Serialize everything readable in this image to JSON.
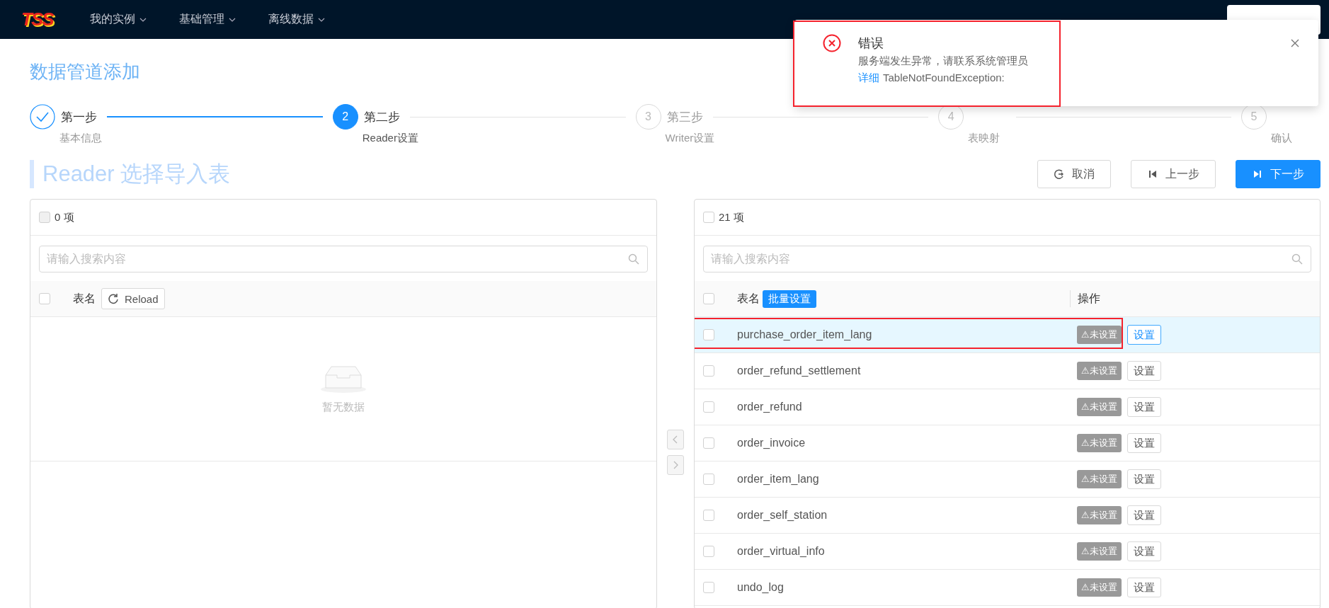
{
  "nav": {
    "logo": "TSS",
    "menus": [
      {
        "label": "我的实例"
      },
      {
        "label": "基础管理"
      },
      {
        "label": "离线数据"
      }
    ]
  },
  "page_title": "数据管道添加",
  "steps": [
    {
      "finished": true,
      "active": false,
      "title": "第一步",
      "description": "基本信息"
    },
    {
      "finished": false,
      "active": true,
      "number": "2",
      "title": "第二步",
      "description": "Reader设置"
    },
    {
      "finished": false,
      "active": false,
      "number": "3",
      "title": "第三步",
      "description": "Writer设置"
    },
    {
      "finished": false,
      "active": false,
      "number": "4",
      "description": "表映射"
    },
    {
      "finished": false,
      "active": false,
      "number": "5",
      "description": "确认"
    }
  ],
  "section_title": "Reader 选择导入表",
  "actions": [
    {
      "kind": "cancel",
      "label": "取消",
      "primary": false
    },
    {
      "kind": "prev",
      "label": "上一步",
      "primary": false
    },
    {
      "kind": "next",
      "label": "下一步",
      "primary": true
    }
  ],
  "source_panel": {
    "count": "0 项",
    "checked": false,
    "disabled": true,
    "search_placeholder": "请输入搜索内容",
    "header_checked": false,
    "column": "表名",
    "reload": "Reload",
    "empty_text": "暂无数据"
  },
  "target_panel": {
    "count": "21 项",
    "checked": false,
    "disabled": false,
    "search_placeholder": "请输入搜索内容",
    "header_checked": false,
    "column": "表名",
    "batch": "批量设置",
    "action_column": "操作",
    "rows": [
      {
        "name": "purchase_order_item_lang",
        "status": "⚠未设置",
        "action": "设置",
        "checked": false,
        "selected": true
      },
      {
        "name": "order_refund_settlement",
        "status": "⚠未设置",
        "action": "设置",
        "checked": false,
        "selected": false
      },
      {
        "name": "order_refund",
        "status": "⚠未设置",
        "action": "设置",
        "checked": false,
        "selected": false
      },
      {
        "name": "order_invoice",
        "status": "⚠未设置",
        "action": "设置",
        "checked": false,
        "selected": false
      },
      {
        "name": "order_item_lang",
        "status": "⚠未设置",
        "action": "设置",
        "checked": false,
        "selected": false
      },
      {
        "name": "order_self_station",
        "status": "⚠未设置",
        "action": "设置",
        "checked": false,
        "selected": false
      },
      {
        "name": "order_virtual_info",
        "status": "⚠未设置",
        "action": "设置",
        "checked": false,
        "selected": false
      },
      {
        "name": "undo_log",
        "status": "⚠未设置",
        "action": "设置",
        "checked": false,
        "selected": false
      }
    ]
  },
  "notification": {
    "title": "错误",
    "message": "服务端发生异常，请联系系统管理员",
    "detail_link": "详细",
    "detail": "TableNotFoundException:",
    "annotated": true
  }
}
